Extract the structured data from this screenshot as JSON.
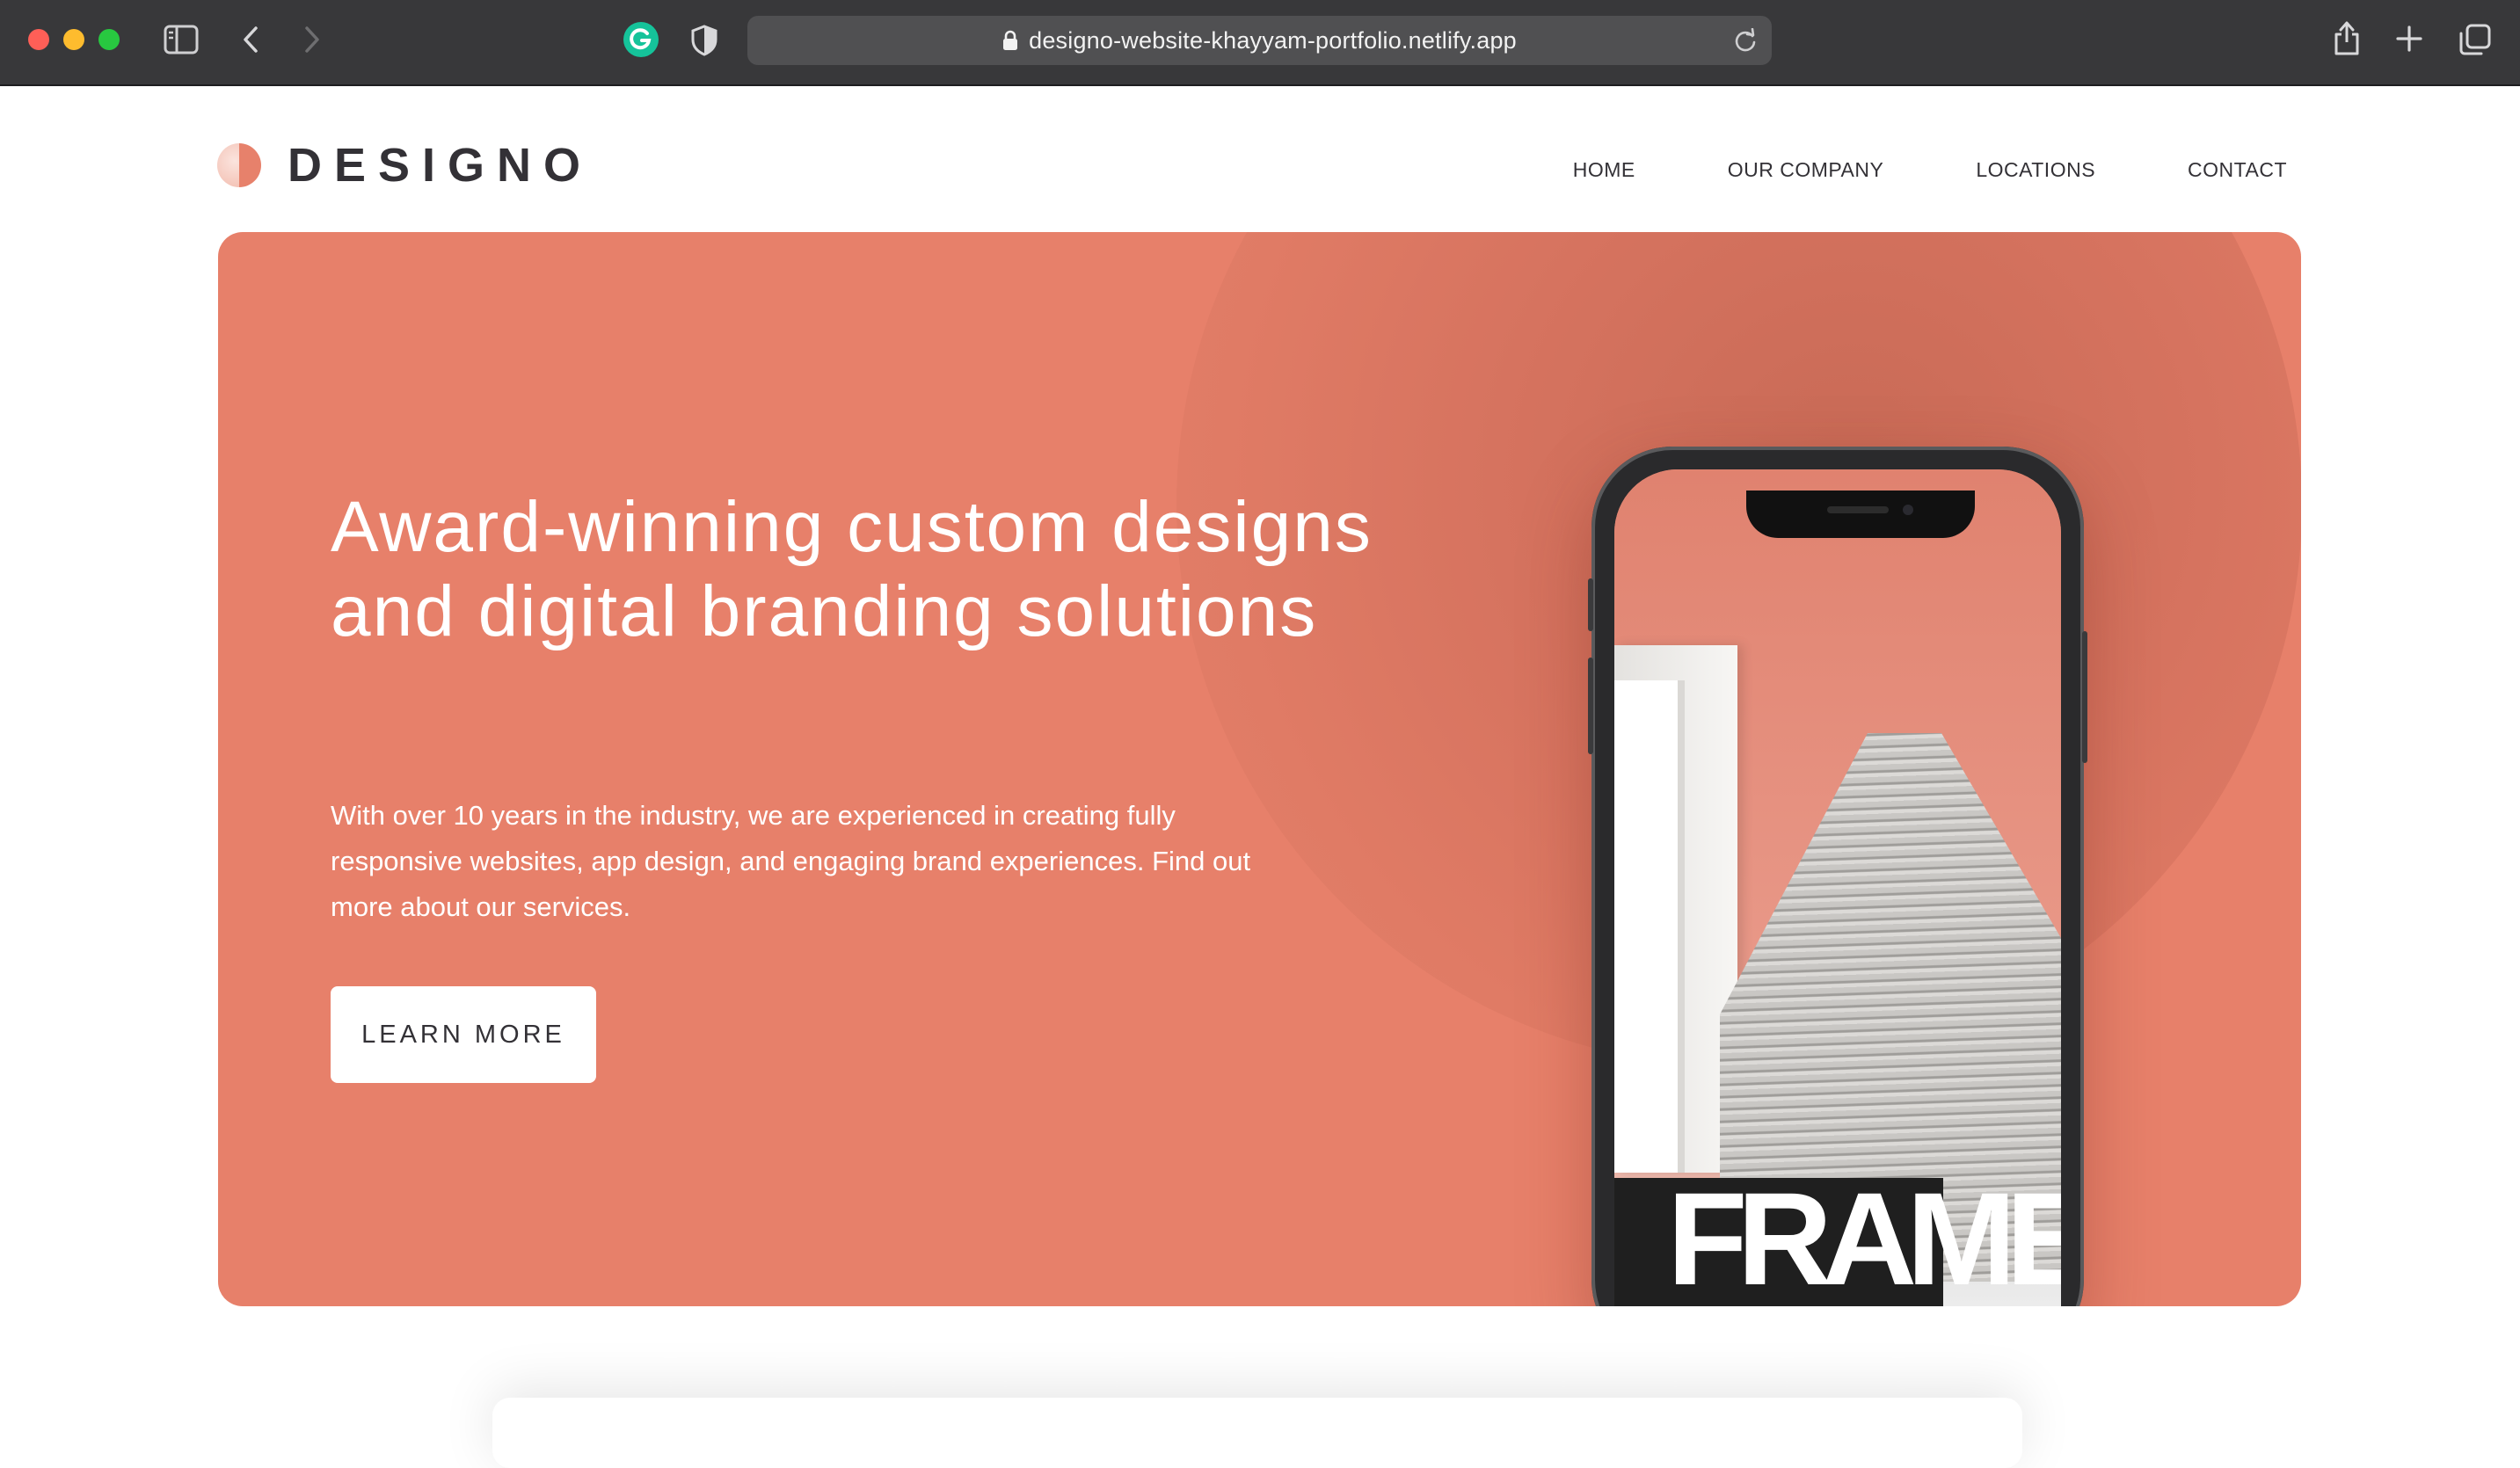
{
  "browser": {
    "url": "designo-website-khayyam-portfolio.netlify.app"
  },
  "header": {
    "logo_text": "DESIGNO",
    "nav": [
      {
        "label": "HOME"
      },
      {
        "label": "OUR COMPANY"
      },
      {
        "label": "LOCATIONS"
      },
      {
        "label": "CONTACT"
      }
    ]
  },
  "hero": {
    "title": "Award-winning custom designs and digital branding solutions",
    "text": "With over 10 years in the industry, we are experienced in creating fully responsive websites, app design, and engaging brand experiences. Find out more about our services.",
    "cta_label": "LEARN MORE",
    "phone_screen_word": "FRAME"
  },
  "colors": {
    "accent": "#e7806a",
    "dark_text": "#333136",
    "chrome_bg": "#38383a"
  }
}
